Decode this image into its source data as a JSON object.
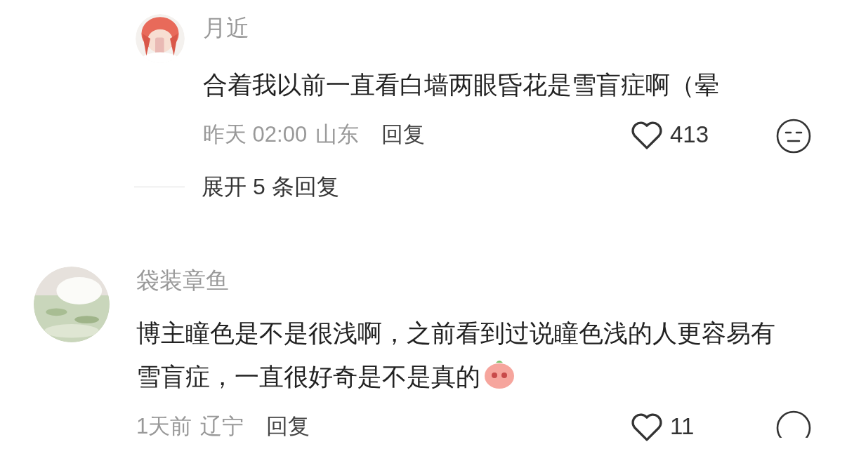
{
  "comments": [
    {
      "kind": "reply",
      "author": "月近",
      "text": "合着我以前一直看白墙两眼昏花是雪盲症啊（晕",
      "time": "昨天 02:00",
      "location": "山东",
      "reply_label": "回复",
      "likes": "413",
      "liked": false,
      "expand_label": "展开 5 条回复"
    },
    {
      "kind": "comment",
      "author": "袋装章鱼",
      "text": "博主瞳色是不是很浅啊，之前看到过说瞳色浅的人更容易有雪盲症，一直很好奇是不是真的",
      "sticker": true,
      "time": "1天前",
      "location": "辽宁",
      "reply_label": "回复",
      "likes": "11",
      "liked": false
    }
  ]
}
